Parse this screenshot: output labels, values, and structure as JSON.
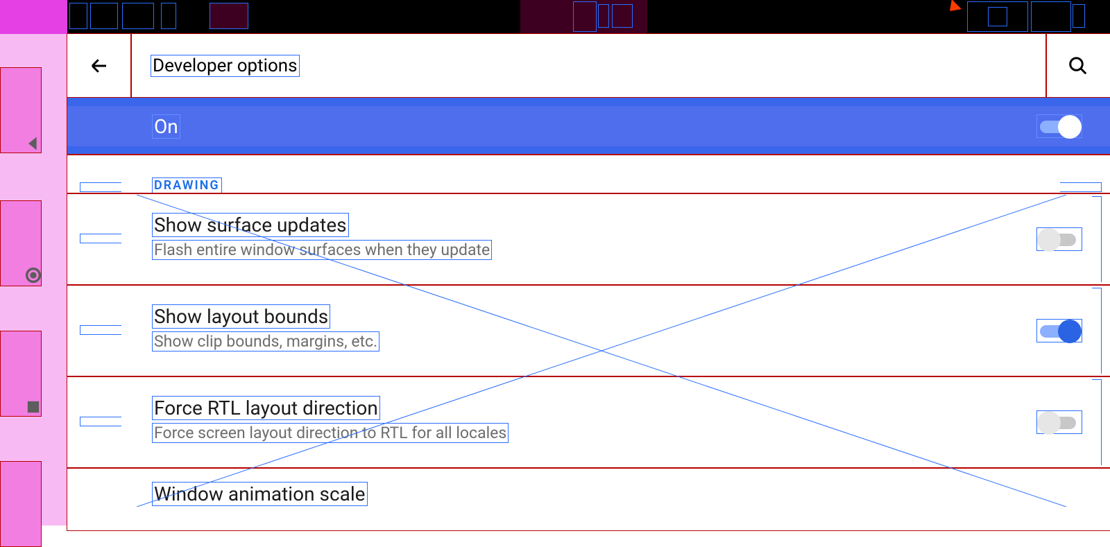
{
  "page_title": "Developer options",
  "master_switch": {
    "label": "On",
    "state": true
  },
  "section_header": "DRAWING",
  "rows": [
    {
      "title": "Show surface updates",
      "subtitle": "Flash entire window surfaces when they update",
      "toggle": false
    },
    {
      "title": "Show layout bounds",
      "subtitle": "Show clip bounds, margins, etc.",
      "toggle": true
    },
    {
      "title": "Force RTL layout direction",
      "subtitle": "Force screen layout direction to RTL for all locales",
      "toggle": false
    },
    {
      "title": "Window animation scale",
      "subtitle": ""
    }
  ],
  "nav": {
    "back": "back",
    "home": "home",
    "recents": "recents"
  }
}
